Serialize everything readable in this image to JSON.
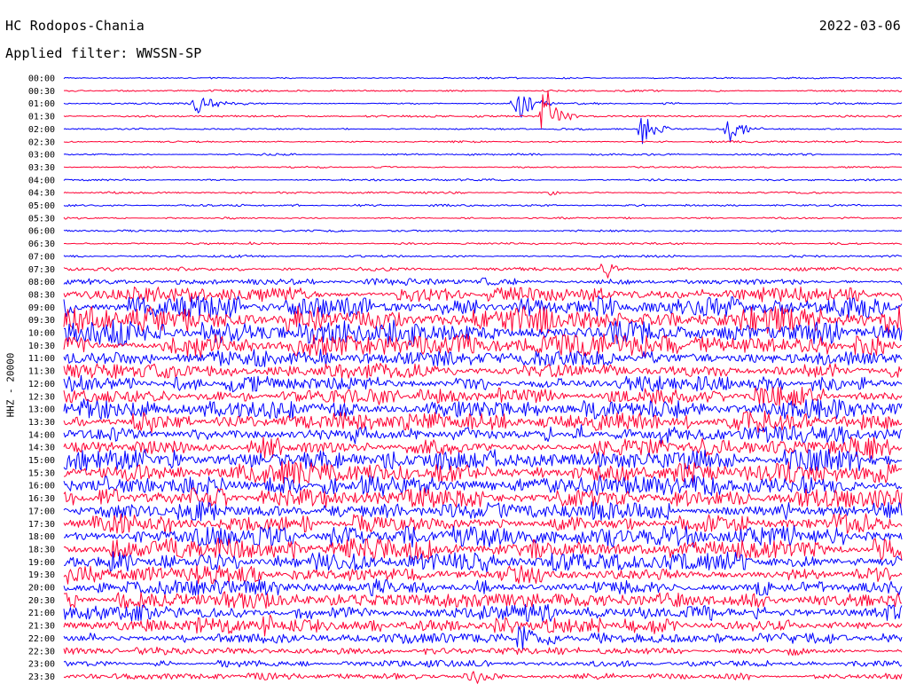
{
  "header": {
    "station": "HC Rodopos-Chania",
    "filter": "Applied filter: WWSSN-SP",
    "date": "2022-03-06",
    "channel": "HHZ - 20000"
  },
  "chart_data": {
    "type": "line",
    "title": "HC Rodopos-Chania",
    "subtitle": "Applied filter: WWSSN-SP",
    "ylabel": "HHZ - 20000",
    "x_domain_minutes": [
      0,
      30
    ],
    "trace_colors": [
      "#0000ff",
      "#ff0033"
    ],
    "grid": false,
    "legend": "none",
    "rows": [
      {
        "label": "00:00",
        "noise": 0.6
      },
      {
        "label": "00:30",
        "noise": 0.6
      },
      {
        "label": "01:00",
        "noise": 0.7
      },
      {
        "label": "01:30",
        "noise": 0.6
      },
      {
        "label": "02:00",
        "noise": 0.6
      },
      {
        "label": "02:30",
        "noise": 0.6
      },
      {
        "label": "03:00",
        "noise": 0.6
      },
      {
        "label": "03:30",
        "noise": 0.6
      },
      {
        "label": "04:00",
        "noise": 0.6
      },
      {
        "label": "04:30",
        "noise": 0.7
      },
      {
        "label": "05:00",
        "noise": 0.7
      },
      {
        "label": "05:30",
        "noise": 0.6
      },
      {
        "label": "06:00",
        "noise": 0.6
      },
      {
        "label": "06:30",
        "noise": 0.6
      },
      {
        "label": "07:00",
        "noise": 0.8
      },
      {
        "label": "07:30",
        "noise": 1.2
      },
      {
        "label": "08:00",
        "noise": 2.2
      },
      {
        "label": "08:30",
        "noise": 4.5
      },
      {
        "label": "09:00",
        "noise": 7.0
      },
      {
        "label": "09:30",
        "noise": 8.0
      },
      {
        "label": "10:00",
        "noise": 7.5
      },
      {
        "label": "10:30",
        "noise": 7.0
      },
      {
        "label": "11:00",
        "noise": 5.0
      },
      {
        "label": "11:30",
        "noise": 4.5
      },
      {
        "label": "12:00",
        "noise": 5.0
      },
      {
        "label": "12:30",
        "noise": 5.5
      },
      {
        "label": "13:00",
        "noise": 6.0
      },
      {
        "label": "13:30",
        "noise": 6.5
      },
      {
        "label": "14:00",
        "noise": 6.0
      },
      {
        "label": "14:30",
        "noise": 6.5
      },
      {
        "label": "15:00",
        "noise": 6.5
      },
      {
        "label": "15:30",
        "noise": 7.0
      },
      {
        "label": "16:00",
        "noise": 6.5
      },
      {
        "label": "16:30",
        "noise": 6.0
      },
      {
        "label": "17:00",
        "noise": 6.0
      },
      {
        "label": "17:30",
        "noise": 6.5
      },
      {
        "label": "18:00",
        "noise": 6.5
      },
      {
        "label": "18:30",
        "noise": 6.5
      },
      {
        "label": "19:00",
        "noise": 6.0
      },
      {
        "label": "19:30",
        "noise": 5.5
      },
      {
        "label": "20:00",
        "noise": 5.0
      },
      {
        "label": "20:30",
        "noise": 5.0
      },
      {
        "label": "21:00",
        "noise": 5.5
      },
      {
        "label": "21:30",
        "noise": 5.0
      },
      {
        "label": "22:00",
        "noise": 3.5
      },
      {
        "label": "22:30",
        "noise": 2.5
      },
      {
        "label": "23:00",
        "noise": 2.0
      },
      {
        "label": "23:30",
        "noise": 2.0
      }
    ],
    "events": [
      {
        "row": 2,
        "minute": 4.8,
        "amplitude": 14,
        "duration_min": 1.8
      },
      {
        "row": 2,
        "minute": 16.2,
        "amplitude": 22,
        "duration_min": 1.6
      },
      {
        "row": 3,
        "minute": 17.2,
        "amplitude": 40,
        "duration_min": 1.2
      },
      {
        "row": 4,
        "minute": 20.7,
        "amplitude": 20,
        "duration_min": 1.3
      },
      {
        "row": 4,
        "minute": 23.8,
        "amplitude": 18,
        "duration_min": 1.3
      },
      {
        "row": 9,
        "minute": 17.4,
        "amplitude": 5,
        "duration_min": 0.8
      },
      {
        "row": 13,
        "minute": 6.6,
        "amplitude": 4,
        "duration_min": 0.6
      },
      {
        "row": 15,
        "minute": 19.3,
        "amplitude": 18,
        "duration_min": 1.0
      },
      {
        "row": 43,
        "minute": 7.2,
        "amplitude": 10,
        "duration_min": 1.0
      },
      {
        "row": 44,
        "minute": 16.3,
        "amplitude": 20,
        "duration_min": 1.2
      },
      {
        "row": 46,
        "minute": 26.6,
        "amplitude": 6,
        "duration_min": 0.6
      },
      {
        "row": 47,
        "minute": 14.6,
        "amplitude": 9,
        "duration_min": 1.2
      }
    ]
  }
}
